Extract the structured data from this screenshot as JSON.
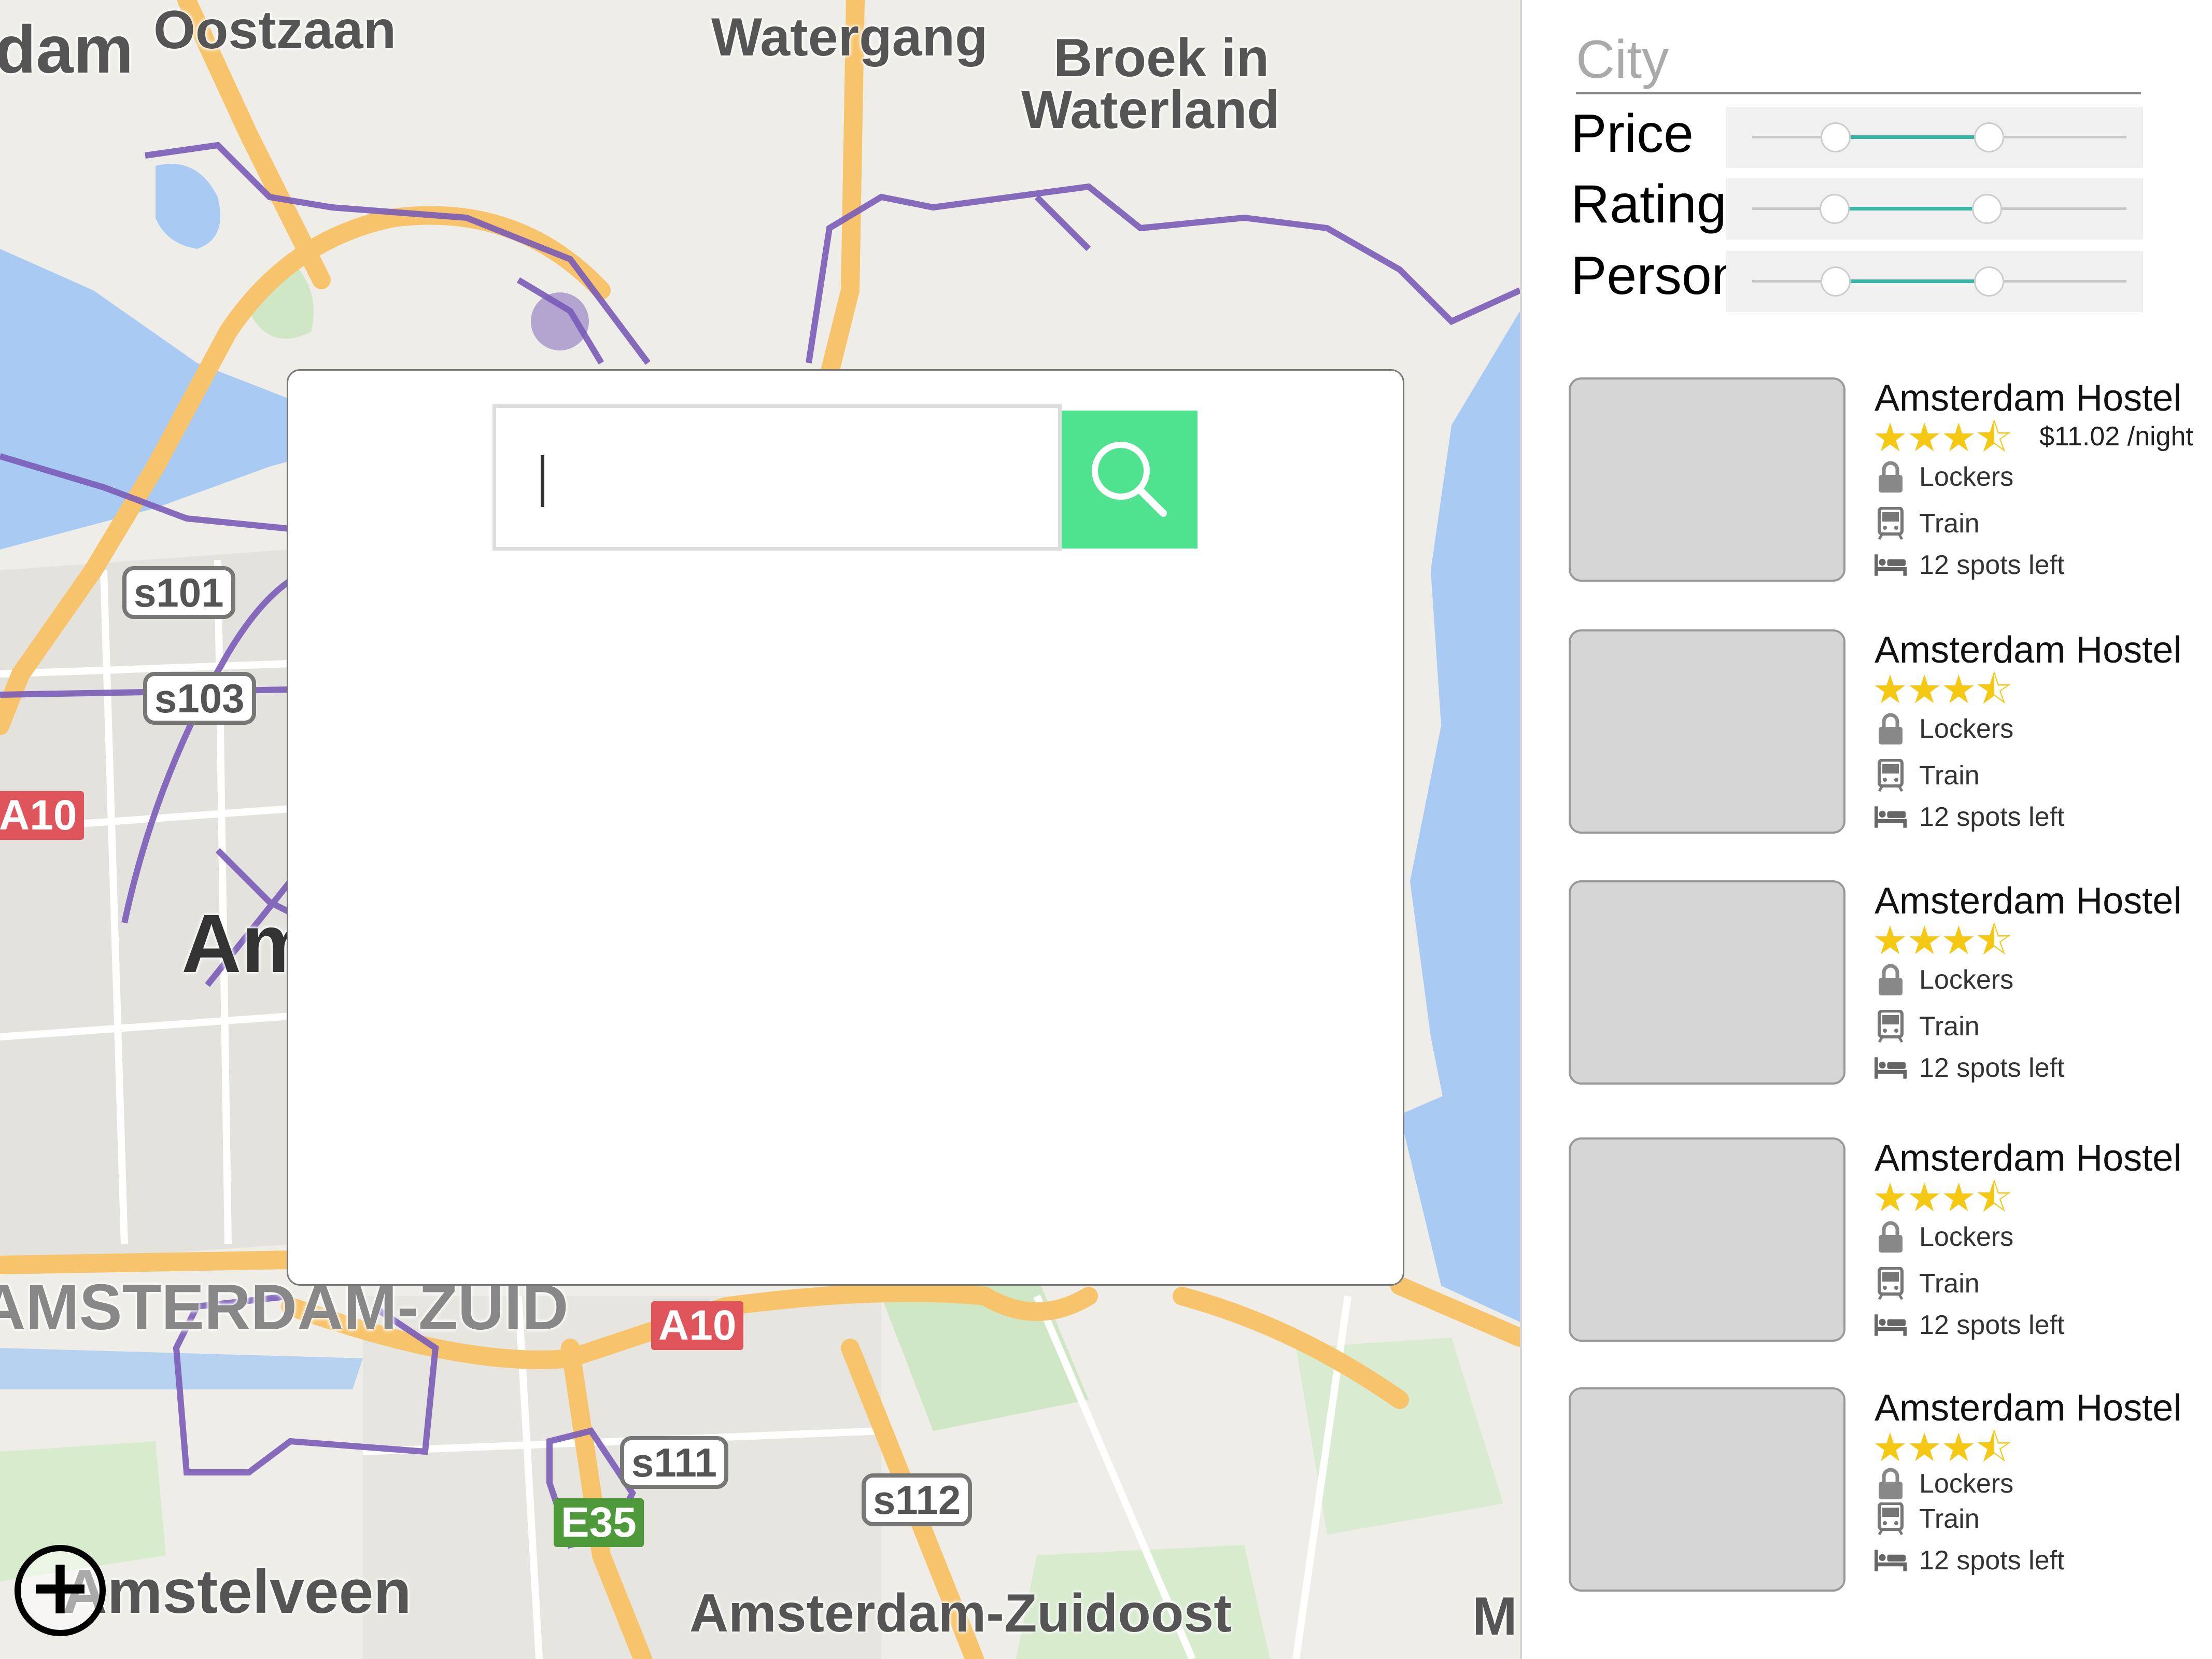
{
  "map": {
    "places": [
      {
        "text": "dam"
      },
      {
        "text": "Oostzaan"
      },
      {
        "text": "Watergang"
      },
      {
        "text": "Broek in"
      },
      {
        "text": "Waterland"
      },
      {
        "text": "Am"
      },
      {
        "text": "AMSTERDAM-ZUID"
      },
      {
        "text": "Amstelveen"
      },
      {
        "text": "Amsterdam-Zuidoost"
      },
      {
        "text": "M"
      }
    ],
    "shields": [
      "s101",
      "s103",
      "s111",
      "s112"
    ],
    "motorways_red": [
      "A10",
      "A10"
    ],
    "motorways_green": [
      "E35"
    ],
    "zoom_label": "+"
  },
  "search": {
    "value": "",
    "placeholder": ""
  },
  "filters": {
    "city_placeholder": "City",
    "price_label": "Price",
    "rating_label": "Rating",
    "person_label": "Person",
    "price_range": {
      "low": 0.2,
      "high": 0.6
    },
    "rating_range": {
      "low": 0.2,
      "high": 0.6
    },
    "person_range": {
      "low": 0.2,
      "high": 0.6
    },
    "accent_color": "#37b6a5"
  },
  "listings": [
    {
      "name": "Amsterdam Hostel",
      "stars": "★★★⯪",
      "rating": 3.5,
      "price": "$11.02 /night",
      "amenity1": "Lockers",
      "amenity2": "Train",
      "spots": "12 spots left"
    },
    {
      "name": "Amsterdam Hostel",
      "stars": "★★★⯪",
      "rating": 3.5,
      "price": "",
      "amenity1": "Lockers",
      "amenity2": "Train",
      "spots": "12 spots left"
    },
    {
      "name": "Amsterdam Hostel",
      "stars": "★★★⯪",
      "rating": 3.5,
      "price": "",
      "amenity1": "Lockers",
      "amenity2": "Train",
      "spots": "12 spots left"
    },
    {
      "name": "Amsterdam Hostel",
      "stars": "★★★⯪",
      "rating": 3.5,
      "price": "",
      "amenity1": "Lockers",
      "amenity2": "Train",
      "spots": "12 spots left"
    },
    {
      "name": "Amsterdam Hostel",
      "stars": "★★★⯪",
      "rating": 3.5,
      "price": "",
      "amenity1": "Lockers",
      "amenity2": "Train",
      "spots": "12 spots left"
    }
  ],
  "colors": {
    "search_button": "#4fe28f",
    "star": "#f5c814"
  }
}
